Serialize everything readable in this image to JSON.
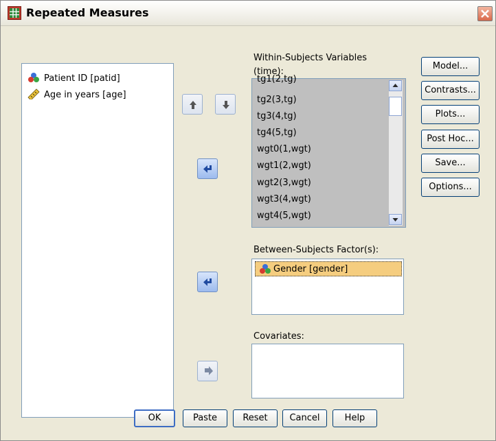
{
  "window": {
    "title": "Repeated Measures"
  },
  "source_variables": [
    {
      "label": "Patient ID [patid]",
      "icon": "nominal-variable-icon"
    },
    {
      "label": "Age in years [age]",
      "icon": "scale-variable-icon"
    }
  ],
  "within": {
    "label_line1": "Within-Subjects Variables",
    "label_line2": "(time):",
    "items": [
      "tg1(2,tg)",
      "tg2(3,tg)",
      "tg3(4,tg)",
      "tg4(5,tg)",
      "wgt0(1,wgt)",
      "wgt1(2,wgt)",
      "wgt2(3,wgt)",
      "wgt3(4,wgt)",
      "wgt4(5,wgt)"
    ]
  },
  "between": {
    "label": "Between-Subjects Factor(s):",
    "items": [
      {
        "label": "Gender [gender]",
        "icon": "nominal-variable-icon"
      }
    ]
  },
  "covariates": {
    "label": "Covariates:",
    "items": []
  },
  "side_buttons": [
    "Model...",
    "Contrasts...",
    "Plots...",
    "Post Hoc...",
    "Save...",
    "Options..."
  ],
  "bottom_buttons": [
    "OK",
    "Paste",
    "Reset",
    "Cancel",
    "Help"
  ],
  "colors": {
    "selection": "#f5cd7f",
    "within_bg": "#bfbfbf",
    "dialog_bg": "#ece9d8",
    "accent": "#3c6cc3"
  }
}
